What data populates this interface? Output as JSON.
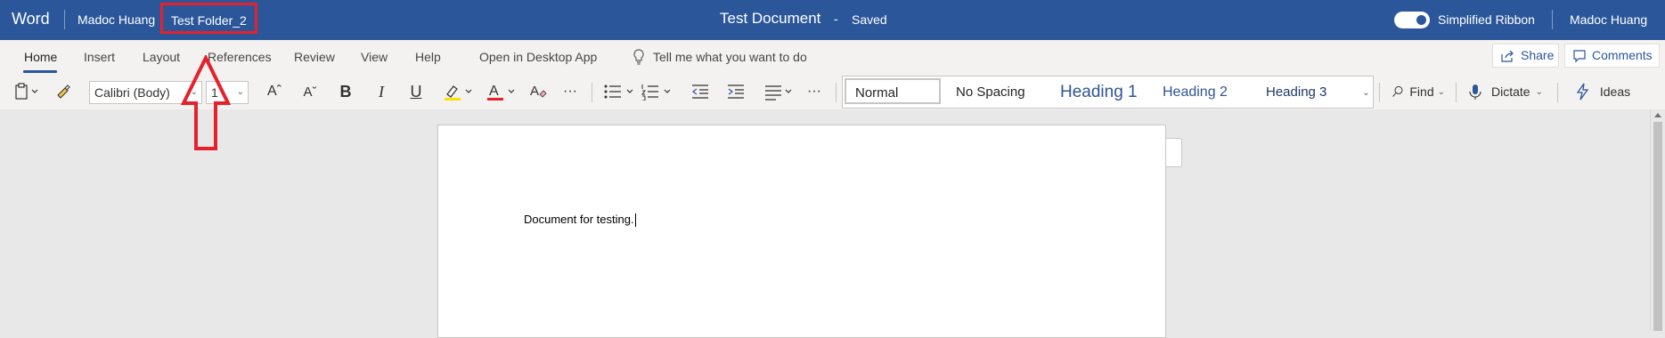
{
  "titlebar": {
    "app_name": "Word",
    "user": "Madoc Huang",
    "folder": "Test Folder_2",
    "document_title": "Test Document",
    "separator": "-",
    "save_status": "Saved",
    "toggle_label": "Simplified Ribbon",
    "toggle_on": true,
    "account": "Madoc Huang"
  },
  "ribbon": {
    "tabs": [
      "Home",
      "Insert",
      "Layout",
      "References",
      "Review",
      "View",
      "Help",
      "Open in Desktop App"
    ],
    "active_tab": "Home",
    "tell_me": "Tell me what you want to do",
    "share": "Share",
    "comments": "Comments"
  },
  "toolbar": {
    "font_name": "Calibri (Body)",
    "font_size": "1",
    "styles": [
      "Normal",
      "No Spacing",
      "Heading 1",
      "Heading 2",
      "Heading 3"
    ],
    "find": "Find",
    "dictate": "Dictate",
    "ideas": "Ideas",
    "accent_color": "#2b579a",
    "highlight_color": "#ffe000",
    "font_color": "#e5212b"
  },
  "document": {
    "text": "Document for testing."
  },
  "annotation": {
    "color": "#e5212b"
  }
}
